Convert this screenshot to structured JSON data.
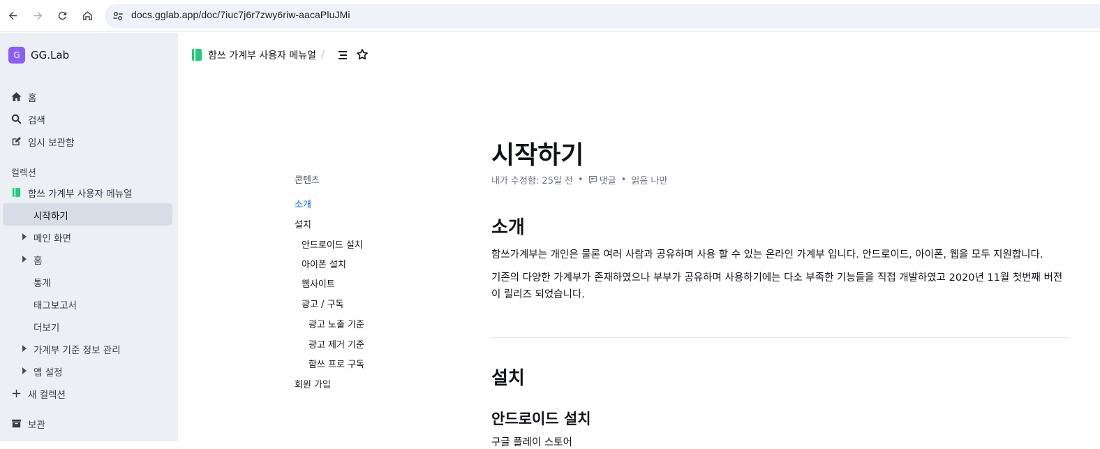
{
  "browser": {
    "url": "docs.gglab.app/doc/7iuc7j6r7zwy6riw-aacaPluJMi"
  },
  "sidebar": {
    "workspace_initial": "G",
    "workspace_name": "GG.Lab",
    "top_items": [
      {
        "label": "홈",
        "icon": "home-icon"
      },
      {
        "label": "검색",
        "icon": "search-icon"
      },
      {
        "label": "임시 보관함",
        "icon": "edit-icon"
      }
    ],
    "collections_heading": "컬렉션",
    "collection_name": "함쓰 가계부 사용자 메뉴얼",
    "doc_items": [
      {
        "label": "시작하기",
        "active": true,
        "expandable": false
      },
      {
        "label": "메인 화면",
        "active": false,
        "expandable": true
      },
      {
        "label": "홈",
        "active": false,
        "expandable": true
      },
      {
        "label": "통계",
        "active": false,
        "expandable": false
      },
      {
        "label": "태그보고서",
        "active": false,
        "expandable": false
      },
      {
        "label": "더보기",
        "active": false,
        "expandable": false
      },
      {
        "label": "가계부 기준 정보 관리",
        "active": false,
        "expandable": true
      },
      {
        "label": "앱 설정",
        "active": false,
        "expandable": true
      }
    ],
    "new_collection": "새 컬렉션",
    "archive": "보관"
  },
  "header": {
    "breadcrumb": "함쓰 가계부 사용자 메뉴얼",
    "separator": "/"
  },
  "toc": {
    "title": "콘텐츠",
    "items": [
      {
        "label": "소개",
        "level": 1,
        "active": true
      },
      {
        "label": "설치",
        "level": 1,
        "active": false
      },
      {
        "label": "안드로이드 설치",
        "level": 2,
        "active": false
      },
      {
        "label": "아이폰 설치",
        "level": 2,
        "active": false
      },
      {
        "label": "웹사이트",
        "level": 2,
        "active": false
      },
      {
        "label": "광고 / 구독",
        "level": 2,
        "active": false
      },
      {
        "label": "광고 노출 기준",
        "level": 3,
        "active": false
      },
      {
        "label": "광고 제거 기준",
        "level": 3,
        "active": false
      },
      {
        "label": "함쓰 프로 구독",
        "level": 3,
        "active": false
      },
      {
        "label": "회원 가입",
        "level": 1,
        "active": false
      }
    ]
  },
  "document": {
    "title": "시작하기",
    "meta_edited": "내가 수정함: 25일 전",
    "meta_dot": "•",
    "meta_comments": "댓글",
    "meta_readers": "읽음 나만",
    "sections": {
      "intro_heading": "소개",
      "intro_p1": "함쓰가계부는 개인은 물론 여러 사람과 공유하며 사용 할 수 있는 온라인 가계부 입니다. 안드로이드, 아이폰, 웹을 모두 지원합니다.",
      "intro_p2": "기존의 다양한 가계부가 존재하였으나 부부가 공유하며 사용하기에는 다소 부족한 기능들을 직접 개발하였고 2020년 11월 첫번째 버전이 릴리즈 되었습니다.",
      "install_heading": "설치",
      "android_heading": "안드로이드 설치",
      "android_cut": "구글 플레이 스토어"
    }
  },
  "colors": {
    "accent": "#0366d6",
    "workspace_logo": "#8b5cf6",
    "collection_icon": "#1fcc7b",
    "sidebar_bg": "#ecf0f4",
    "sidebar_active": "#d6dde6"
  }
}
